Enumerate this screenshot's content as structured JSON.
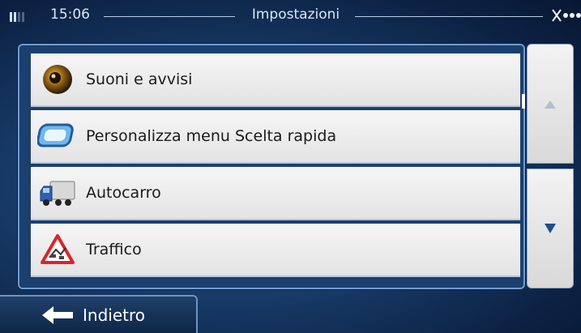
{
  "status_bar": {
    "time": "15:06",
    "title": "Impostazioni",
    "signal_icon": "signal-bars-icon",
    "gps_icon": "gps-satellite-icon"
  },
  "menu": {
    "items": [
      {
        "label": "Suoni e avvisi",
        "icon": "speaker-icon"
      },
      {
        "label": "Personalizza menu Scelta rapida",
        "icon": "shortcut-menu-icon"
      },
      {
        "label": "Autocarro",
        "icon": "truck-icon"
      },
      {
        "label": "Traffico",
        "icon": "traffic-warning-icon"
      }
    ]
  },
  "scroll": {
    "up_icon": "arrow-up-icon",
    "down_icon": "arrow-down-icon"
  },
  "footer": {
    "back_label": "Indietro",
    "back_icon": "arrow-left-icon"
  },
  "colors": {
    "background": "#173a66",
    "panel_border": "#6f9bd0",
    "item_background": "#eeeeee",
    "scroll_down_arrow": "#1f4f8a"
  }
}
